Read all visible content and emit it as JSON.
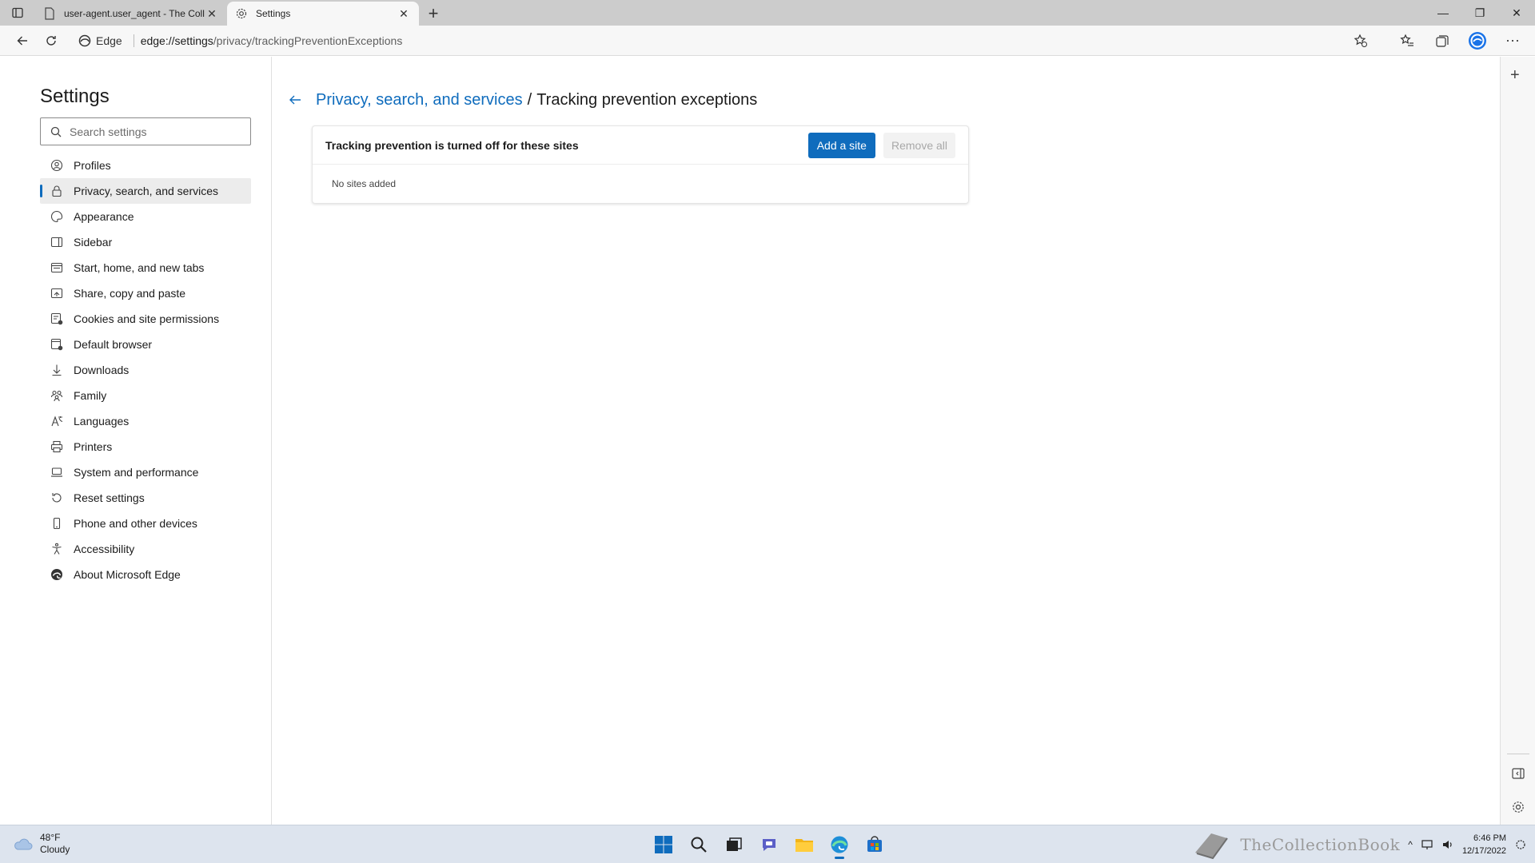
{
  "browser": {
    "tabs": [
      {
        "title": "user-agent.user_agent - The Coll",
        "active": false,
        "icon": "page-icon"
      },
      {
        "title": "Settings",
        "active": true,
        "icon": "gear-icon"
      }
    ],
    "window_controls": {
      "minimize": "—",
      "restore": "❐",
      "close": "✕"
    },
    "address": {
      "edge_label": "Edge",
      "url_host": "edge://settings",
      "url_path": "/privacy/trackingPreventionExceptions"
    }
  },
  "settings": {
    "title": "Settings",
    "search_placeholder": "Search settings",
    "nav": [
      {
        "label": "Profiles",
        "icon": "profile-icon"
      },
      {
        "label": "Privacy, search, and services",
        "icon": "lock-icon",
        "selected": true
      },
      {
        "label": "Appearance",
        "icon": "appearance-icon"
      },
      {
        "label": "Sidebar",
        "icon": "sidebar-icon"
      },
      {
        "label": "Start, home, and new tabs",
        "icon": "home-tabs-icon"
      },
      {
        "label": "Share, copy and paste",
        "icon": "share-icon"
      },
      {
        "label": "Cookies and site permissions",
        "icon": "cookies-icon"
      },
      {
        "label": "Default browser",
        "icon": "default-browser-icon"
      },
      {
        "label": "Downloads",
        "icon": "download-icon"
      },
      {
        "label": "Family",
        "icon": "family-icon"
      },
      {
        "label": "Languages",
        "icon": "languages-icon"
      },
      {
        "label": "Printers",
        "icon": "printer-icon"
      },
      {
        "label": "System and performance",
        "icon": "laptop-icon"
      },
      {
        "label": "Reset settings",
        "icon": "reset-icon"
      },
      {
        "label": "Phone and other devices",
        "icon": "phone-icon"
      },
      {
        "label": "Accessibility",
        "icon": "accessibility-icon"
      },
      {
        "label": "About Microsoft Edge",
        "icon": "edge-logo-icon"
      }
    ]
  },
  "main": {
    "breadcrumb_parent": "Privacy, search, and services",
    "breadcrumb_sep": "/",
    "breadcrumb_current": "Tracking prevention exceptions",
    "card_heading": "Tracking prevention is turned off for these sites",
    "add_button": "Add a site",
    "remove_button": "Remove all",
    "empty_text": "No sites added"
  },
  "taskbar": {
    "temperature": "48°F",
    "condition": "Cloudy",
    "watermark": "TheCollectionBook",
    "time": "6:46 PM",
    "date": "12/17/2022"
  },
  "colors": {
    "accent": "#0f6cbd",
    "tabstrip": "#cccccc",
    "taskbar": "#dde4ee"
  }
}
